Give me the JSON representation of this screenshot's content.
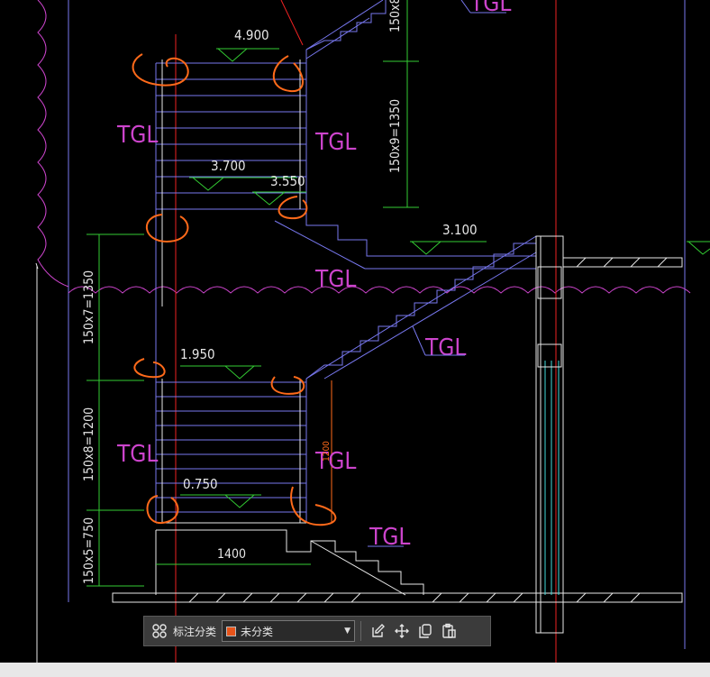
{
  "colors": {
    "stair": "#7777ee",
    "dimension": "#33cc33",
    "axis": "#ee2222",
    "label": "#cc44cc",
    "markup": "#ff6a1a",
    "white": "#e8e8e8",
    "elevation": "#e6e6e6",
    "toolbar_swatch": "#e8541a"
  },
  "drawing": {
    "elevations": {
      "top": "4.900",
      "upper_landing": "3.700",
      "upper_landing_b": "3.550",
      "right_floor": "3.100",
      "middle_landing": "1.950",
      "lower_landing": "0.750"
    },
    "labels": {
      "tgl_top": "TGL",
      "tgl_upper_left": "TGL",
      "tgl_upper_right": "TGL",
      "tgl_middle": "TGL",
      "tgl_right_ramp": "TGL",
      "tgl_lower_left": "TGL",
      "tgl_lower_right": "TGL",
      "tgl_bottom": "TGL"
    },
    "dimensions": {
      "top_right_partial": "150x8",
      "upper_right": "150x9=1350",
      "left_upper": "150x7=1350",
      "left_middle": "150x8=1200",
      "left_lower": "150x5=750",
      "bottom_width": "1400",
      "vertical_small": "1200"
    }
  },
  "toolbar": {
    "label": "标注分类",
    "select_value": "未分类",
    "icons": [
      "grid-icon",
      "edit-icon",
      "move-icon",
      "copy-icon",
      "paste-icon"
    ]
  }
}
